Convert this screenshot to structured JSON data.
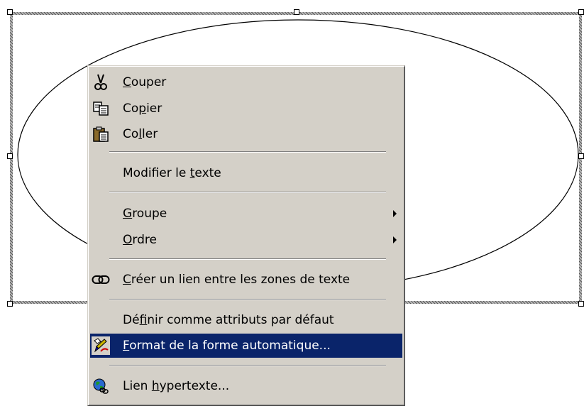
{
  "menu": {
    "items": [
      {
        "pre": "",
        "acc": "C",
        "post": "ouper",
        "icon": "scissors-icon"
      },
      {
        "pre": "Co",
        "acc": "p",
        "post": "ier",
        "icon": "copy-icon"
      },
      {
        "pre": "Co",
        "acc": "l",
        "post": "ler",
        "icon": "paste-icon"
      },
      {
        "pre": "Modifier le ",
        "acc": "t",
        "post": "exte",
        "icon": ""
      },
      {
        "pre": "",
        "acc": "G",
        "post": "roupe",
        "icon": "",
        "submenu": true
      },
      {
        "pre": "",
        "acc": "O",
        "post": "rdre",
        "icon": "",
        "submenu": true
      },
      {
        "pre": "",
        "acc": "C",
        "post": "réer un lien entre les zones de texte",
        "icon": "chain-link-icon"
      },
      {
        "pre": "Dé",
        "acc": "f",
        "post": "inir comme attributs par défaut",
        "icon": ""
      },
      {
        "pre": "",
        "acc": "F",
        "post": "ormat de la forme automatique...",
        "icon": "format-shape-icon",
        "highlighted": true
      },
      {
        "pre": "Lien ",
        "acc": "h",
        "post": "ypertexte...",
        "icon": "hyperlink-globe-icon"
      }
    ]
  },
  "colors": {
    "menu_bg": "#d4d0c8",
    "highlight": "#0a246a"
  }
}
